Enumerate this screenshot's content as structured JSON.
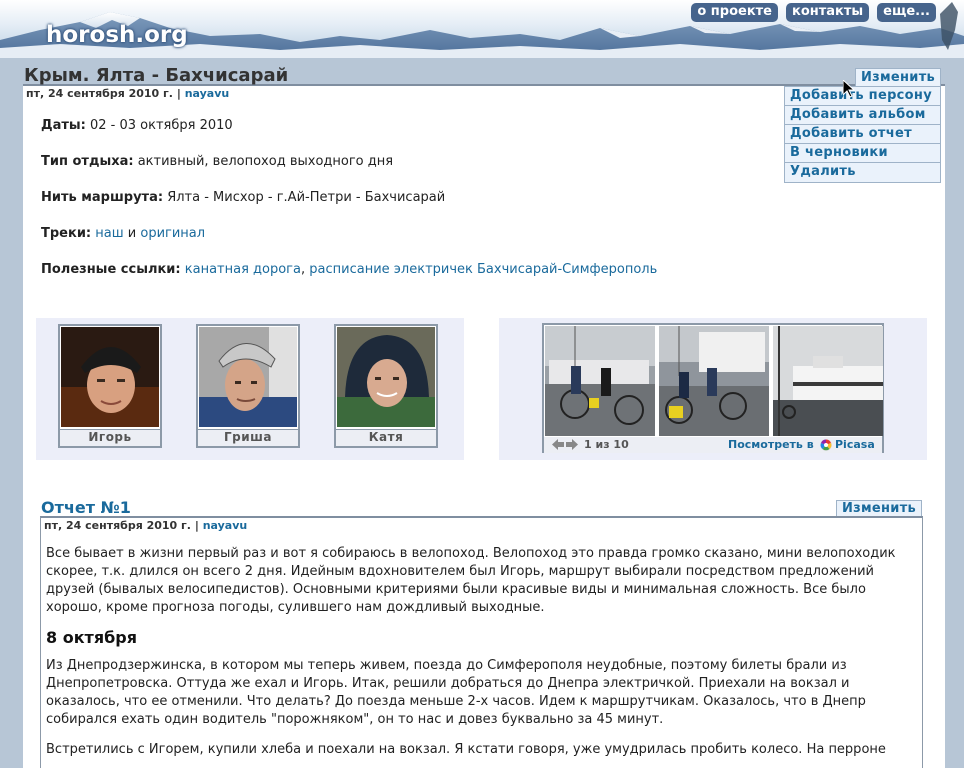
{
  "site": {
    "logo": "horosh.org"
  },
  "topnav": [
    "о проекте",
    "контакты",
    "еще..."
  ],
  "page": {
    "title": "Крым. Ялта - Бахчисарай",
    "date": "пт, 24 сентября 2010 г.",
    "separator": "|",
    "author": "nayavu",
    "edit_label": "Изменить"
  },
  "actions": [
    "Добавить персону",
    "Добавить альбом",
    "Добавить отчет",
    "В черновики",
    "Удалить"
  ],
  "info": {
    "dates": {
      "label": "Даты:",
      "value": "02 - 03 октября 2010"
    },
    "type": {
      "label": "Тип отдыха:",
      "value": "активный, велопоход выходного дня"
    },
    "route": {
      "label": "Нить маршрута:",
      "value": "Ялта - Мисхор - г.Ай-Петри - Бахчисарай"
    },
    "tracks": {
      "label": "Треки:",
      "link1": "наш",
      "conj": "и",
      "link2": "оригинал"
    },
    "links": {
      "label": "Полезные ссылки:",
      "link1": "канатная дорога",
      "comma": ",",
      "link2": "расписание электричек Бахчисарай-Симферополь"
    }
  },
  "people": [
    "Игорь",
    "Гриша",
    "Катя"
  ],
  "album": {
    "counter": "1 из 10",
    "view_label": "Посмотреть в",
    "service": "Picasa"
  },
  "report": {
    "title": "Отчет №1",
    "edit_label": "Изменить",
    "date": "пт, 24 сентября 2010 г.",
    "separator": "|",
    "author": "nayavu",
    "p1": "Все бывает в жизни первый раз и вот я собираюсь в велопоход. Велопоход это правда громко сказано, мини велопоходик скорее, т.к. длился он всего 2 дня. Идейным вдохновителем был Игорь, маршрут выбирали посредством предложений друзей (бывалых велосипедистов). Основными критериями были красивые виды и минимальная сложность. Все было хорошо, кроме прогноза погоды, сулившего нам дождливый выходные.",
    "heading": "8 октября",
    "p2": "Из Днепродзержинска, в котором мы теперь живем, поезда до Симферополя неудобные, поэтому билеты брали из Днепропетровска. Оттуда же ехал и Игорь. Итак, решили добраться до Днепра электричкой. Приехали на вокзал и оказалось, что ее отменили. Что делать? До поезда меньше 2-х часов. Идем к маршрутчикам. Оказалось, что в Днепр собирался ехать один водитель \"порожняком\", он то нас и довез буквально за 45 минут.",
    "p3": "Встретились с Игорем, купили хлеба и поехали на вокзал. Я кстати говоря, уже умудрилась пробить колесо. На перроне"
  }
}
